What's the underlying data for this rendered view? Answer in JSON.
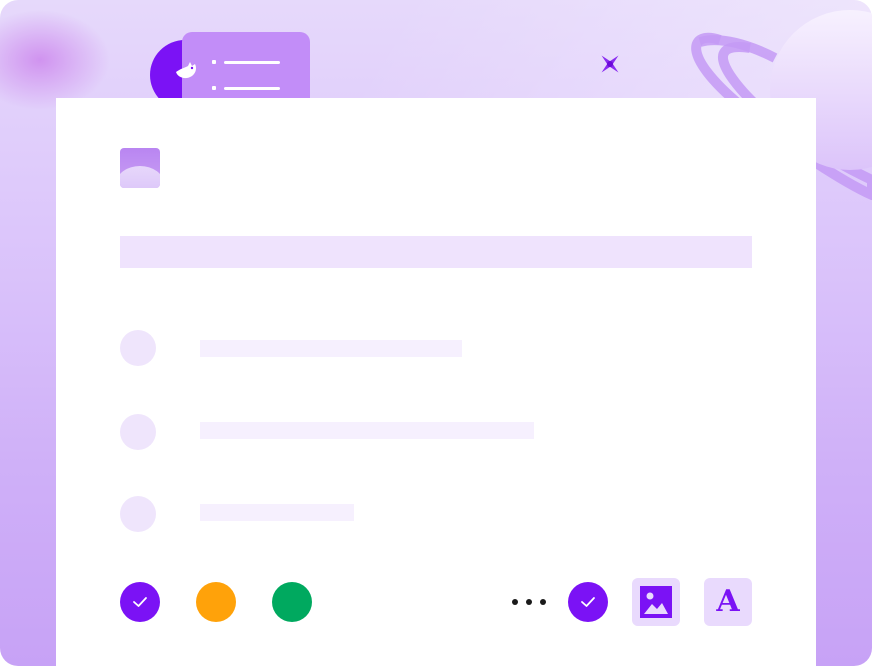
{
  "colors": {
    "accent": "#7b12f5",
    "orange": "#ffa20a",
    "green": "#00a95f",
    "panel": "#ffffff",
    "placeholder": "#efe3fd"
  },
  "header_badge": {
    "icons": [
      "bird-icon",
      "list-icon"
    ]
  },
  "decorations": {
    "sparkle": "sparkle-icon",
    "planet": "planet-icon"
  },
  "form": {
    "logo_icon": "image-logo-icon",
    "options_count": 3
  },
  "toolbar": {
    "swatches": [
      {
        "name": "purple",
        "color": "#7b12f5",
        "selected": true
      },
      {
        "name": "orange",
        "color": "#ffa20a",
        "selected": false
      },
      {
        "name": "green",
        "color": "#00a95f",
        "selected": false
      }
    ],
    "more_icon": "more-horizontal-icon",
    "confirm_icon": "check-icon",
    "image_tool_icon": "image-icon",
    "text_tool_glyph": "A"
  }
}
